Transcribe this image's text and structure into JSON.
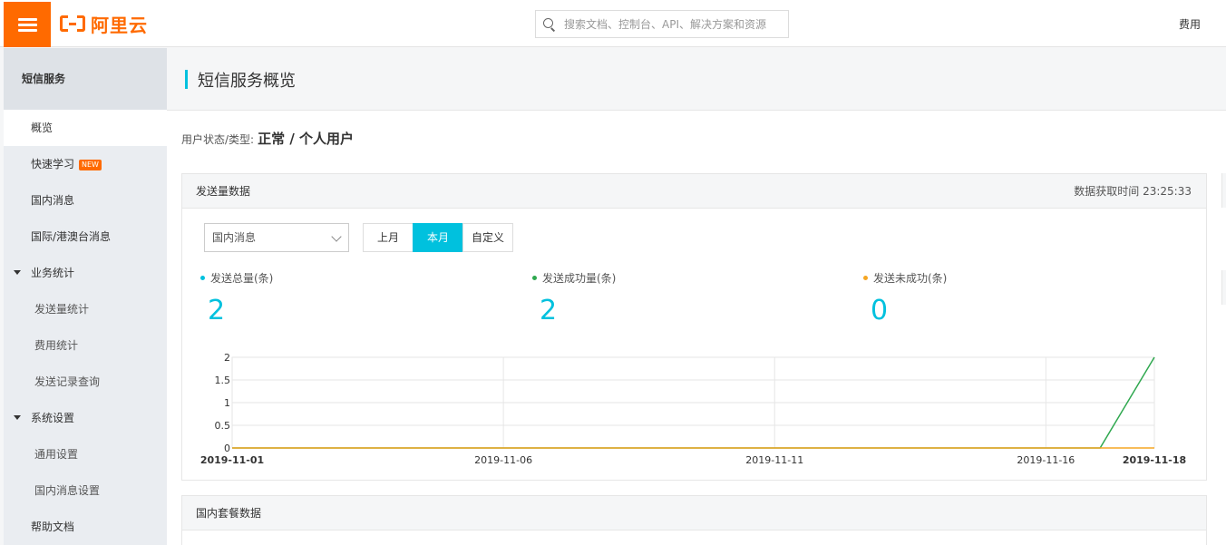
{
  "app": {
    "logo_text": "阿里云"
  },
  "header": {
    "search_placeholder": "搜索文档、控制台、API、解决方案和资源",
    "fees_label": "费用"
  },
  "sidebar": {
    "title": "短信服务",
    "items": [
      {
        "label": "概览"
      },
      {
        "label": "快速学习",
        "badge": "NEW"
      },
      {
        "label": "国内消息"
      },
      {
        "label": "国际/港澳台消息"
      },
      {
        "label": "业务统计"
      },
      {
        "label": "发送量统计"
      },
      {
        "label": "费用统计"
      },
      {
        "label": "发送记录查询"
      },
      {
        "label": "系统设置"
      },
      {
        "label": "通用设置"
      },
      {
        "label": "国内消息设置"
      },
      {
        "label": "帮助文档"
      }
    ]
  },
  "main": {
    "page_title": "短信服务概览",
    "user_status_label": "用户状态/类型:",
    "user_status_value": "正常 / 个人用户",
    "send_panel": {
      "title": "发送量数据",
      "fetch_time": "数据获取时间 23:25:33",
      "select_value": "国内消息",
      "range_buttons": [
        "上月",
        "本月",
        "自定义"
      ],
      "active_range": "本月",
      "stats": [
        {
          "label": "发送总量(条)",
          "value": "2",
          "color": "#00c1de"
        },
        {
          "label": "发送成功量(条)",
          "value": "2",
          "color": "#2fa84f"
        },
        {
          "label": "发送未成功(条)",
          "value": "0",
          "color": "#f5a623"
        }
      ]
    },
    "package_panel": {
      "title": "国内套餐数据"
    }
  },
  "chart_data": {
    "type": "line",
    "x": [
      "2019-11-01",
      "2019-11-02",
      "2019-11-03",
      "2019-11-04",
      "2019-11-05",
      "2019-11-06",
      "2019-11-07",
      "2019-11-08",
      "2019-11-09",
      "2019-11-10",
      "2019-11-11",
      "2019-11-12",
      "2019-11-13",
      "2019-11-14",
      "2019-11-15",
      "2019-11-16",
      "2019-11-17",
      "2019-11-18"
    ],
    "x_tick_labels": [
      "2019-11-01",
      "2019-11-06",
      "2019-11-11",
      "2019-11-16",
      "2019-11-18"
    ],
    "y_ticks": [
      "0",
      "0.5",
      "1",
      "1.5",
      "2"
    ],
    "ylim": [
      0,
      2
    ],
    "series": [
      {
        "color": "#2fa84f",
        "values": [
          0,
          0,
          0,
          0,
          0,
          0,
          0,
          0,
          0,
          0,
          0,
          0,
          0,
          0,
          0,
          0,
          0,
          2
        ]
      },
      {
        "color": "#f5a623",
        "values": [
          0,
          0,
          0,
          0,
          0,
          0,
          0,
          0,
          0,
          0,
          0,
          0,
          0,
          0,
          0,
          0,
          0,
          0
        ]
      }
    ],
    "grid": true
  }
}
